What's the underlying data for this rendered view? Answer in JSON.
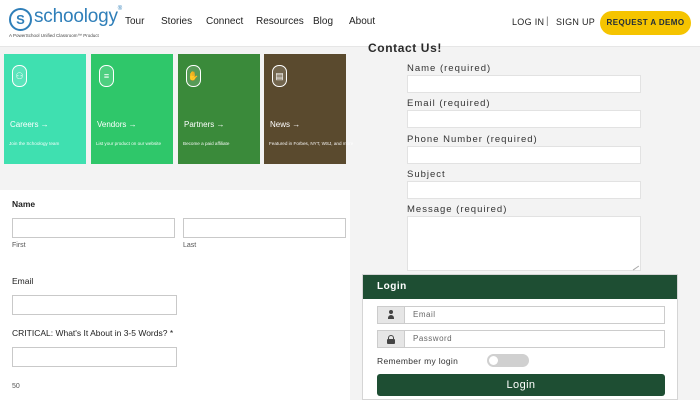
{
  "brand": {
    "logo_letter": "S",
    "logo_word": "schoology",
    "logo_reg": "®",
    "tagline": "A PowerSchool Unified Classroom™ Product"
  },
  "nav": {
    "links": [
      "Tour",
      "Stories",
      "Connect",
      "Resources",
      "Blog",
      "About"
    ],
    "login": "LOG IN",
    "separator": "|",
    "signup": "SIGN UP",
    "demo": "REQUEST A DEMO"
  },
  "tiles": [
    {
      "title": "Careers →",
      "desc": "Join the Schoology team",
      "color": "#3fe0b0",
      "icon": "people-icon",
      "glyph": "⚇"
    },
    {
      "title": "Vendors →",
      "desc": "List your product on our website",
      "color": "#2fc76a",
      "icon": "document-icon",
      "glyph": "≡"
    },
    {
      "title": "Partners →",
      "desc": "Become a paid affiliate",
      "color": "#3a8a3a",
      "icon": "handshake-icon",
      "glyph": "✋"
    },
    {
      "title": "News →",
      "desc": "Featured in Forbes, NYT, WSJ, and more",
      "color": "#5a4a2e",
      "icon": "newspaper-icon",
      "glyph": "▤"
    }
  ],
  "form": {
    "name_label": "Name",
    "first_label": "First",
    "last_label": "Last",
    "email_label": "Email",
    "critical_label": "CRITICAL: What's It About in 3-5 Words? *",
    "char_limit": "50"
  },
  "contact": {
    "title": "Contact Us!",
    "fields": [
      "Name (required)",
      "Email (required)",
      "Phone Number (required)",
      "Subject",
      "Message (required)"
    ]
  },
  "login": {
    "header": "Login",
    "email_placeholder": "Email",
    "password_placeholder": "Password",
    "remember": "Remember my login",
    "remember_on": false,
    "button": "Login"
  },
  "colors": {
    "brand_blue": "#2f7fb9",
    "demo_yellow": "#f5c400",
    "login_green": "#1e4e33"
  }
}
